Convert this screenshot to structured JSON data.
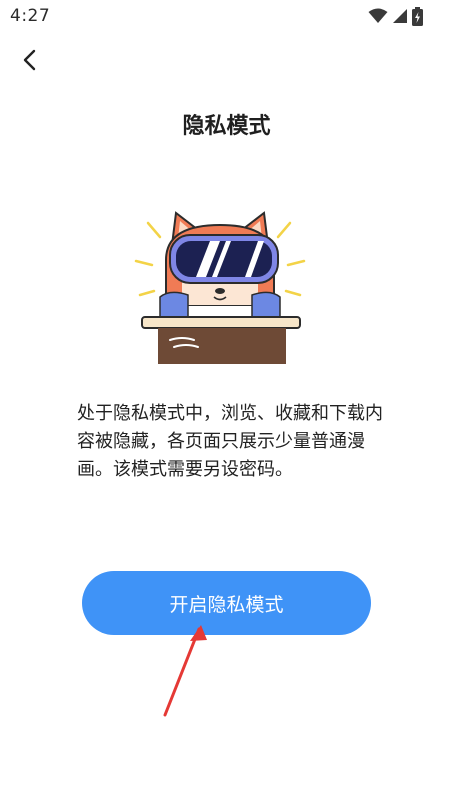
{
  "status_bar": {
    "time": "4:27",
    "icons": [
      "wifi-icon",
      "signal-icon",
      "battery-charging-icon"
    ]
  },
  "header": {
    "back_icon": "chevron-left-icon",
    "title": "隐私模式"
  },
  "main": {
    "illustration": "cat-with-vr-goggles",
    "description": "处于隐私模式中，浏览、收藏和下载内容被隐藏，各页面只展示少量普通漫画。该模式需要另设密码。",
    "button_label": "开启隐私模式",
    "colors": {
      "button": "#3f93f7",
      "annotation_arrow": "#e53935"
    }
  }
}
